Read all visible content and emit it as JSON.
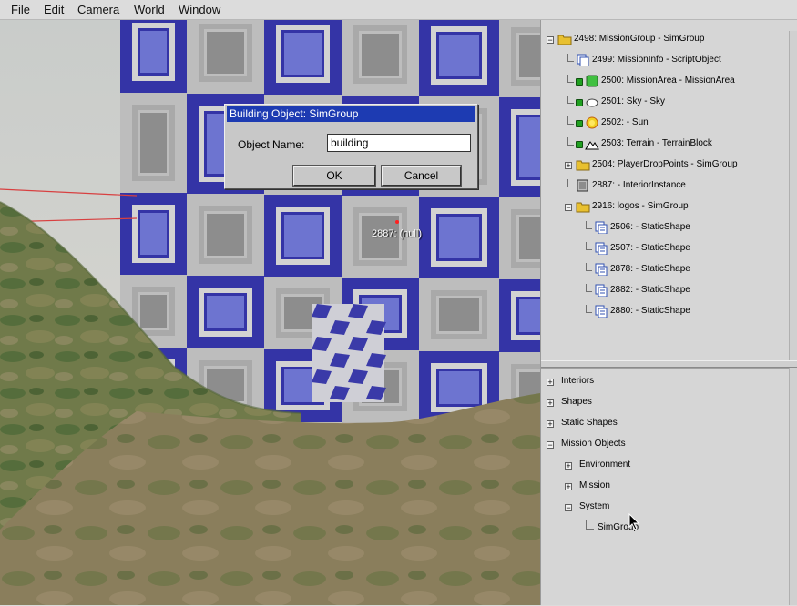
{
  "menu": [
    "File",
    "Edit",
    "Camera",
    "World",
    "Window"
  ],
  "dialog": {
    "title": "Building Object: SimGroup",
    "label": "Object Name:",
    "value": "building",
    "ok": "OK",
    "cancel": "Cancel"
  },
  "viewport": {
    "object_label": "2887: (null)"
  },
  "tree_top": [
    {
      "label": "2498: MissionGroup - SimGroup",
      "icon": "folder-icon",
      "level": 0,
      "lock": false,
      "expander": "minus"
    },
    {
      "label": "2499: MissionInfo - ScriptObject",
      "icon": "script-object-icon",
      "level": 1,
      "lock": false,
      "expander": "none"
    },
    {
      "label": "2500: MissionArea - MissionArea",
      "icon": "mission-area-icon",
      "level": 1,
      "lock": true,
      "expander": "none"
    },
    {
      "label": "2501: Sky - Sky",
      "icon": "sky-icon",
      "level": 1,
      "lock": true,
      "expander": "none"
    },
    {
      "label": "2502: - Sun",
      "icon": "sun-icon",
      "level": 1,
      "lock": true,
      "expander": "none"
    },
    {
      "label": "2503: Terrain - TerrainBlock",
      "icon": "terrain-icon",
      "level": 1,
      "lock": true,
      "expander": "none"
    },
    {
      "label": "2504: PlayerDropPoints - SimGroup",
      "icon": "folder-icon",
      "level": 1,
      "lock": false,
      "expander": "plus"
    },
    {
      "label": "2887: - InteriorInstance",
      "icon": "interior-icon",
      "level": 1,
      "lock": false,
      "expander": "none"
    },
    {
      "label": "2916: logos - SimGroup",
      "icon": "folder-icon",
      "level": 1,
      "lock": false,
      "expander": "minus"
    },
    {
      "label": "2506: - StaticShape",
      "icon": "static-shape-icon",
      "level": 2,
      "lock": false,
      "expander": "none"
    },
    {
      "label": "2507: - StaticShape",
      "icon": "static-shape-icon",
      "level": 2,
      "lock": false,
      "expander": "none"
    },
    {
      "label": "2878: - StaticShape",
      "icon": "static-shape-icon",
      "level": 2,
      "lock": false,
      "expander": "none"
    },
    {
      "label": "2882: - StaticShape",
      "icon": "static-shape-icon",
      "level": 2,
      "lock": false,
      "expander": "none"
    },
    {
      "label": "2880: - StaticShape",
      "icon": "static-shape-icon",
      "level": 2,
      "lock": false,
      "expander": "none"
    }
  ],
  "tree_bottom": [
    {
      "label": "Interiors",
      "level": 0,
      "expander": "plus"
    },
    {
      "label": "Shapes",
      "level": 0,
      "expander": "plus"
    },
    {
      "label": "Static Shapes",
      "level": 0,
      "expander": "plus"
    },
    {
      "label": "Mission Objects",
      "level": 0,
      "expander": "minus"
    },
    {
      "label": "Environment",
      "level": 1,
      "expander": "plus"
    },
    {
      "label": "Mission",
      "level": 1,
      "expander": "plus"
    },
    {
      "label": "System",
      "level": 1,
      "expander": "minus"
    },
    {
      "label": "SimGroup",
      "level": 2,
      "expander": "none"
    }
  ]
}
